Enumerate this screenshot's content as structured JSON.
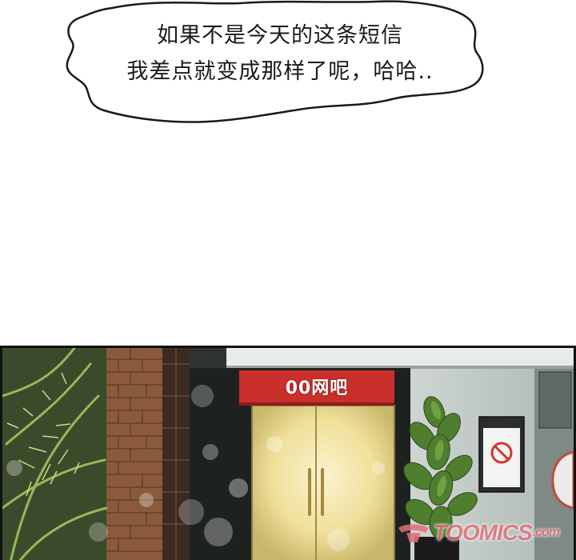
{
  "speech_bubble": {
    "line1": "如果不是今天的这条短信",
    "line2": "我差点就变成那样了呢，哈哈.."
  },
  "scene": {
    "store_sign": "00网吧",
    "door_label": "",
    "no_entry_sign_icon": "no-entry-icon"
  },
  "watermark": {
    "brand": "TOOMICS",
    "domain": ".com"
  },
  "colors": {
    "sign_red": "#c9302c",
    "door_glow": "#f3e6a6",
    "watermark_pink": "#e0707a"
  }
}
